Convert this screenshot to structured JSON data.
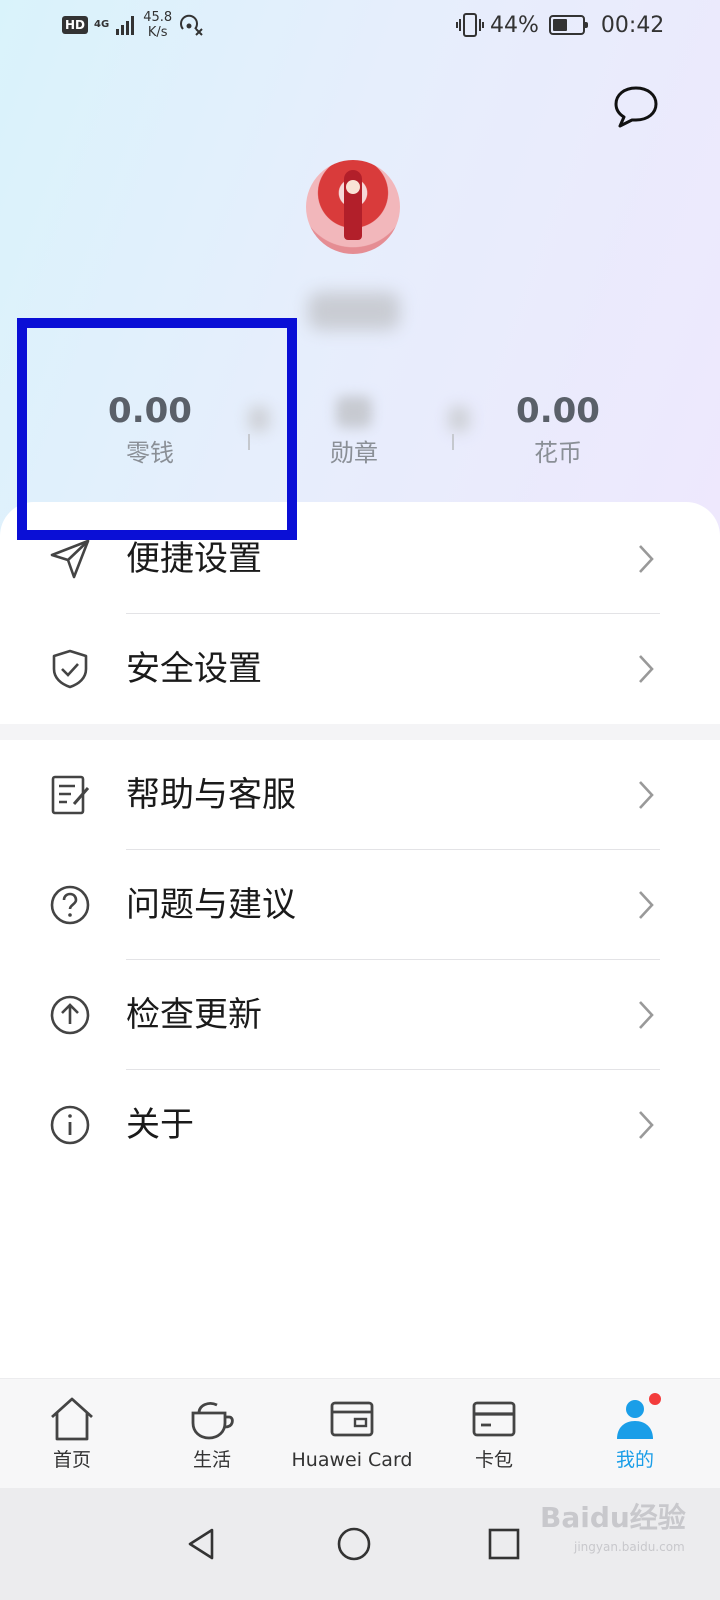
{
  "status_bar": {
    "hd": "HD",
    "network": "4G",
    "speed_value": "45.8",
    "speed_unit": "K/s",
    "battery_percent": "44%",
    "battery_level": 0.44,
    "time": "00:42"
  },
  "profile": {
    "stats": [
      {
        "value": "0.00",
        "label": "零钱"
      },
      {
        "value": "",
        "label": "勋章"
      },
      {
        "value": "0.00",
        "label": "花币"
      }
    ]
  },
  "menu": {
    "group1": [
      {
        "label": "便捷设置",
        "icon": "send-icon"
      },
      {
        "label": "安全设置",
        "icon": "shield-icon"
      }
    ],
    "group2": [
      {
        "label": "帮助与客服",
        "icon": "edit-note-icon"
      },
      {
        "label": "问题与建议",
        "icon": "question-icon"
      },
      {
        "label": "检查更新",
        "icon": "upload-arrow-icon"
      },
      {
        "label": "关于",
        "icon": "info-icon"
      }
    ]
  },
  "tabs": [
    {
      "label": "首页",
      "icon": "home-icon"
    },
    {
      "label": "生活",
      "icon": "cup-icon"
    },
    {
      "label": "Huawei Card",
      "icon": "card-icon"
    },
    {
      "label": "卡包",
      "icon": "wallet-icon"
    },
    {
      "label": "我的",
      "icon": "person-icon",
      "active": true
    }
  ],
  "watermark": {
    "brand": "Baidu经验",
    "url": "jingyan.baidu.com"
  },
  "colors": {
    "active_tab": "#1a9ee8",
    "highlight_box": "#0a0fd6",
    "notify_dot": "#f33c3c"
  }
}
